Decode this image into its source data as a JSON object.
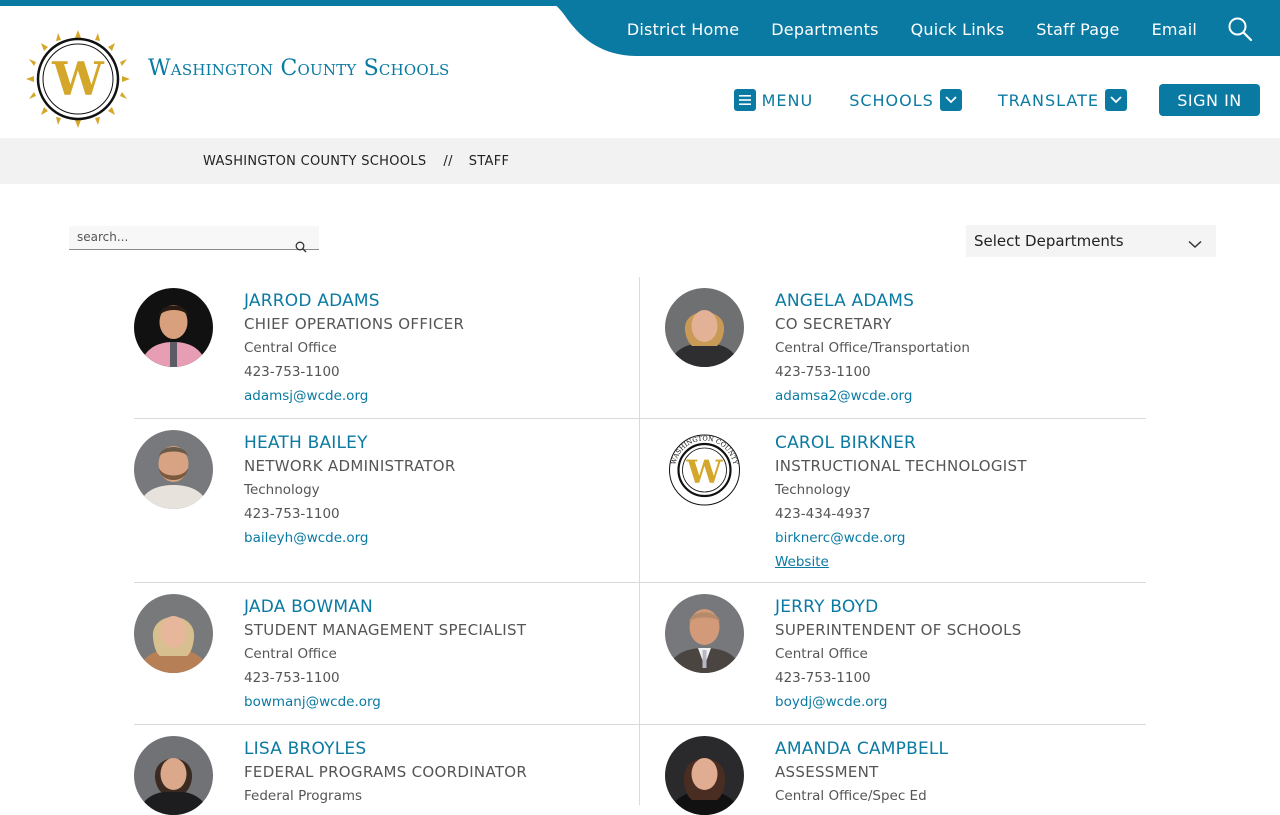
{
  "utility_nav": [
    "District Home",
    "Departments",
    "Quick Links",
    "Staff Page",
    "Email"
  ],
  "site_name": "Washington County Schools",
  "main_nav": {
    "menu": "MENU",
    "schools": "SCHOOLS",
    "translate": "TRANSLATE",
    "sign_in": "SIGN IN"
  },
  "breadcrumb": {
    "home": "WASHINGTON COUNTY SCHOOLS",
    "separator": "//",
    "current": "STAFF"
  },
  "search": {
    "placeholder": "search..."
  },
  "department_filter": {
    "selected": "Select Departments"
  },
  "colors": {
    "accent": "#0b7aa3",
    "gold": "#d4a62a"
  },
  "staff": [
    {
      "name": "JARROD ADAMS",
      "title": "CHIEF OPERATIONS OFFICER",
      "department": "Central Office",
      "phone": "423-753-1100",
      "email": "adamsj@wcde.org",
      "photo": "man-pink-shirt"
    },
    {
      "name": "ANGELA ADAMS",
      "title": "CO SECRETARY",
      "department": "Central Office/Transportation",
      "phone": "423-753-1100",
      "email": "adamsa2@wcde.org",
      "photo": "woman-blonde-dark-top"
    },
    {
      "name": "HEATH BAILEY",
      "title": "NETWORK ADMINISTRATOR",
      "department": "Technology",
      "phone": "423-753-1100",
      "email": "baileyh@wcde.org",
      "photo": "man-beard-plaid"
    },
    {
      "name": "CAROL BIRKNER",
      "title": "INSTRUCTIONAL TECHNOLOGIST",
      "department": "Technology",
      "phone": "423-434-4937",
      "email": "birknerc@wcde.org",
      "website": "Website",
      "photo": "district-logo",
      "seal_text": "WASHINGTON COUNTY"
    },
    {
      "name": "JADA BOWMAN",
      "title": "STUDENT MANAGEMENT SPECIALIST",
      "department": "Central Office",
      "phone": "423-753-1100",
      "email": "bowmanj@wcde.org",
      "photo": "woman-blonde-tan-top"
    },
    {
      "name": "JERRY BOYD",
      "title": "SUPERINTENDENT OF SCHOOLS",
      "department": "Central Office",
      "phone": "423-753-1100",
      "email": "boydj@wcde.org",
      "photo": "man-suit"
    },
    {
      "name": "LISA BROYLES",
      "title": "FEDERAL PROGRAMS COORDINATOR",
      "department": "Federal Programs",
      "phone": "",
      "email": "",
      "photo": "woman-dark-hair"
    },
    {
      "name": "AMANDA CAMPBELL",
      "title": "ASSESSMENT",
      "department": "Central Office/Spec Ed",
      "phone": "",
      "email": "",
      "photo": "woman-dark-hair-2"
    }
  ]
}
